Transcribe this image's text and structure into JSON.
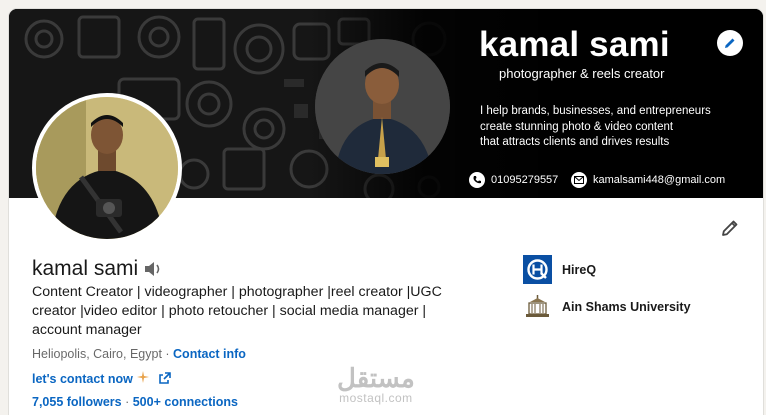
{
  "banner": {
    "name": "kamal sami",
    "tagline": "photographer & reels creator",
    "pitch": [
      "I help brands, businesses, and entrepreneurs",
      "create stunning photo & video content",
      "that attracts clients and drives results"
    ],
    "phone": "01095279557",
    "email": "kamalsami448@gmail.com"
  },
  "profile": {
    "name": "kamal sami",
    "headline": "Content Creator | videographer | photographer |reel creator |UGC creator |video editor | photo retoucher | social media manager | account manager",
    "location": "Heliopolis, Cairo, Egypt",
    "separator": " · ",
    "contact_info": "Contact info",
    "contact_now": "let's contact now",
    "followers": "7,055 followers",
    "stat_sep": " · ",
    "connections": "500+ connections"
  },
  "experience": {
    "company": "HireQ",
    "school": "Ain Shams University"
  },
  "watermark": {
    "arabic": "مستقل",
    "latin": "mostaql.com"
  },
  "colors": {
    "link": "#0a66c2",
    "banner_bg": "#151515",
    "hireq_brand": "#0a4fa3"
  },
  "icons": {
    "sound": "speaker-icon",
    "edit": "pencil-icon",
    "external": "external-link-icon",
    "phone": "phone-icon",
    "email": "mail-icon",
    "sparkle": "sparkle-icon"
  }
}
